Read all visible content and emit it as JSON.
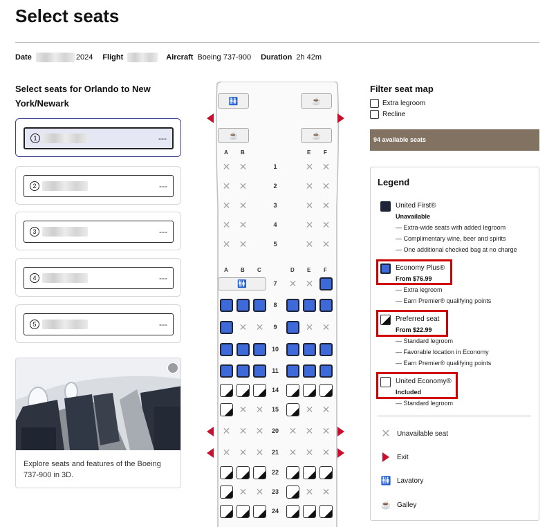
{
  "page_title": "Select seats",
  "trip": {
    "date_label": "Date",
    "date_year": "2024",
    "flight_label": "Flight",
    "aircraft_label": "Aircraft",
    "aircraft_value": "Boeing 737-900",
    "duration_label": "Duration",
    "duration_value": "2h 42m"
  },
  "left": {
    "title": "Select seats for Orlando to New York/Newark",
    "passengers": [
      {
        "num": "1",
        "seat": "---"
      },
      {
        "num": "2",
        "seat": "---"
      },
      {
        "num": "3",
        "seat": "---"
      },
      {
        "num": "4",
        "seat": "---"
      },
      {
        "num": "5",
        "seat": "---"
      }
    ],
    "photo_caption": "Explore seats and features of the Boeing 737-900 in 3D."
  },
  "seatmap": {
    "first_cols": [
      "A",
      "B",
      "E",
      "F"
    ],
    "econ_cols": [
      "A",
      "B",
      "C",
      "D",
      "E",
      "F"
    ],
    "first_rows": [
      {
        "num": "1",
        "seats": [
          "x",
          "x",
          "x",
          "x"
        ]
      },
      {
        "num": "2",
        "seats": [
          "x",
          "x",
          "x",
          "x"
        ]
      },
      {
        "num": "3",
        "seats": [
          "x",
          "x",
          "x",
          "x"
        ]
      },
      {
        "num": "4",
        "seats": [
          "x",
          "x",
          "x",
          "x"
        ]
      },
      {
        "num": "5",
        "seats": [
          "x",
          "x",
          "x",
          "x"
        ]
      }
    ],
    "econ_rows": [
      {
        "num": "7",
        "seats": [
          "lav",
          "lav",
          "lav",
          "x",
          "x",
          "plus"
        ]
      },
      {
        "num": "8",
        "seats": [
          "plus",
          "plus",
          "plus",
          "plus",
          "plus",
          "plus"
        ]
      },
      {
        "num": "9",
        "seats": [
          "plus",
          "x",
          "x",
          "plus",
          "x",
          "x"
        ]
      },
      {
        "num": "10",
        "seats": [
          "plus",
          "plus",
          "plus",
          "plus",
          "plus",
          "plus"
        ]
      },
      {
        "num": "11",
        "seats": [
          "plus",
          "plus",
          "plus",
          "plus",
          "plus",
          "plus"
        ]
      },
      {
        "num": "14",
        "seats": [
          "pref",
          "pref",
          "pref",
          "pref",
          "pref",
          "pref"
        ]
      },
      {
        "num": "15",
        "seats": [
          "pref",
          "x",
          "x",
          "pref",
          "x",
          "x"
        ]
      },
      {
        "num": "20",
        "seats": [
          "x",
          "x",
          "x",
          "x",
          "x",
          "x"
        ]
      },
      {
        "num": "21",
        "seats": [
          "x",
          "x",
          "x",
          "x",
          "x",
          "x"
        ]
      },
      {
        "num": "22",
        "seats": [
          "pref",
          "pref",
          "pref",
          "pref",
          "pref",
          "pref"
        ]
      },
      {
        "num": "23",
        "seats": [
          "pref",
          "x",
          "x",
          "pref",
          "x",
          "x"
        ]
      },
      {
        "num": "24",
        "seats": [
          "pref",
          "pref",
          "pref",
          "pref",
          "pref",
          "pref"
        ]
      }
    ]
  },
  "filter": {
    "title": "Filter seat map",
    "options": [
      "Extra legroom",
      "Recline"
    ],
    "available_text": "94 available seats"
  },
  "legend": {
    "title": "Legend",
    "united_first": {
      "name": "United First®",
      "sub": "Unavailable",
      "features": [
        "— Extra-wide seats with added legroom",
        "— Complimentary wine, beer and spirits",
        "— One additional checked bag at no charge"
      ]
    },
    "economy_plus": {
      "name": "Economy Plus®",
      "sub": "From $76.99",
      "features": [
        "— Extra legroom",
        "— Earn Premier® qualifying points"
      ]
    },
    "preferred": {
      "name": "Preferred seat",
      "sub": "From $22.99",
      "features": [
        "— Standard legroom",
        "— Favorable location in Economy",
        "— Earn Premier® qualifying points"
      ]
    },
    "economy": {
      "name": "United Economy®",
      "sub": "Included",
      "features": [
        "— Standard legroom"
      ]
    },
    "keys": [
      "Unavailable seat",
      "Exit",
      "Lavatory",
      "Galley"
    ]
  },
  "colors": {
    "economy_plus": "#3d6ad8",
    "exit": "#c8102e",
    "highlight": "#d00000",
    "available_bar": "#817262"
  }
}
